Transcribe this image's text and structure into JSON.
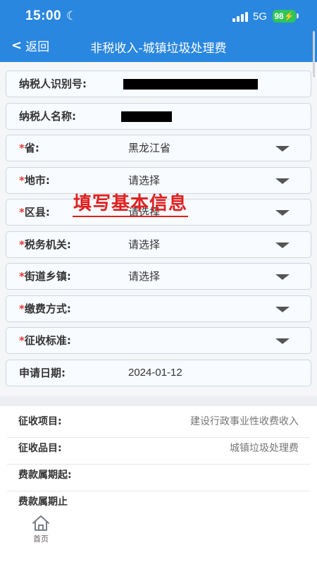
{
  "status": {
    "time": "15:00",
    "network": "5G",
    "battery": "98"
  },
  "nav": {
    "back_label": "返回",
    "title": "非税收入-城镇垃圾处理费"
  },
  "form": {
    "taxpayer_id": {
      "label": "纳税人识别号:",
      "value": ""
    },
    "taxpayer_name": {
      "label": "纳税人名称:",
      "value": ""
    },
    "province": {
      "label": "省:",
      "value": "黑龙江省",
      "required": true
    },
    "city": {
      "label": "地市:",
      "value": "请选择",
      "required": true
    },
    "county": {
      "label": "区县:",
      "value": "请选择",
      "required": true
    },
    "tax_office": {
      "label": "税务机关:",
      "value": "请选择",
      "required": true
    },
    "street": {
      "label": "街道乡镇:",
      "value": "请选择",
      "required": true
    },
    "payment_method": {
      "label": "缴费方式:",
      "value": "",
      "required": true
    },
    "levy_standard": {
      "label": "征收标准:",
      "value": "",
      "required": true
    },
    "apply_date": {
      "label": "申请日期:",
      "value": "2024-01-12"
    }
  },
  "overlay_text": "填写基本信息",
  "info": {
    "levy_item": {
      "label": "征收项目:",
      "value": "建设行政事业性收费收入"
    },
    "levy_subitem": {
      "label": "征收品目:",
      "value": "城镇垃圾处理费"
    },
    "period_start": {
      "label": "费款属期起:",
      "value": ""
    },
    "period_end": {
      "label": "费款属期止",
      "value": ""
    }
  },
  "tabbar": {
    "home_label": "首页"
  },
  "colors": {
    "header_blue": "#2a87e0",
    "required_red": "#e53935",
    "overlay_red": "#e02020",
    "battery_green": "#2ec45a"
  },
  "icons": [
    "moon-icon",
    "signal-icon",
    "battery-icon",
    "chevron-left-icon",
    "dropdown-arrow-icon",
    "home-icon"
  ]
}
